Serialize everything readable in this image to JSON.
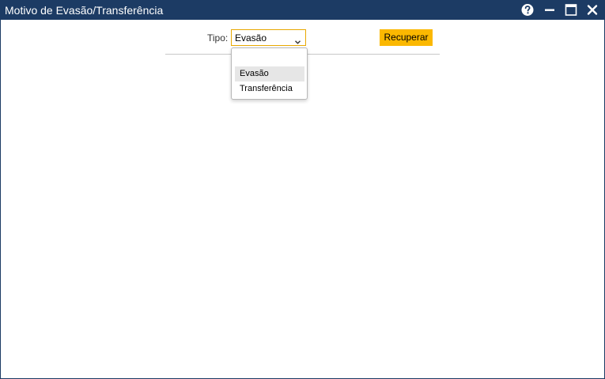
{
  "window": {
    "title": "Motivo de Evasão/Transferência",
    "controls": [
      "help-icon",
      "minimize-icon",
      "maximize-icon",
      "close-icon"
    ],
    "title_bar_color": "#1c3b64"
  },
  "form": {
    "tipo_label": "Tipo:",
    "tipo_selected": "Evasão",
    "tipo_options": [
      "",
      "Evasão",
      "Transferência"
    ],
    "recuperar_label": "Recuperar",
    "accent_color": "#fbb800"
  },
  "dropdown": {
    "open": true,
    "highlighted": "Evasão"
  }
}
